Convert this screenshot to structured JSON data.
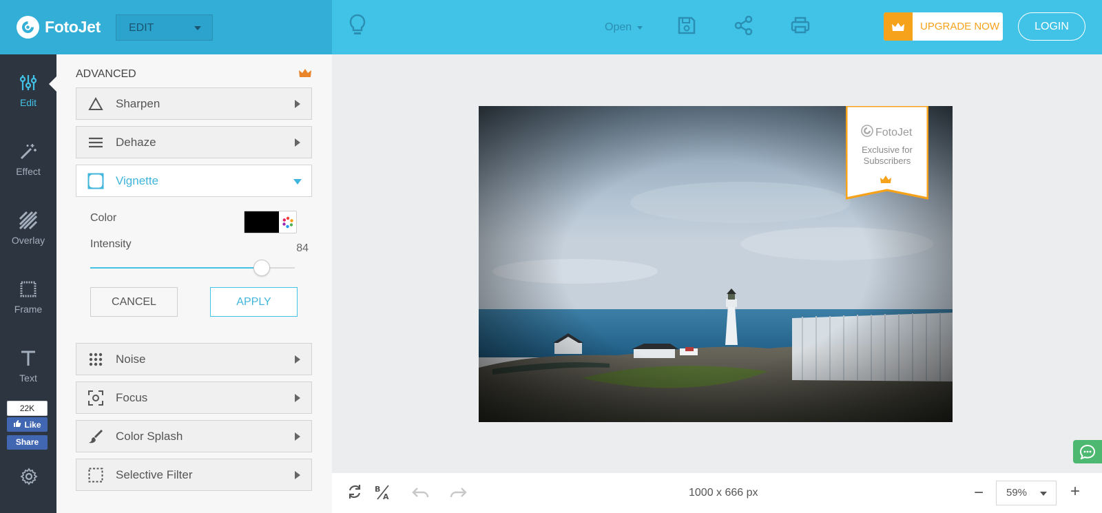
{
  "header": {
    "brand": "FotoJet",
    "mode_label": "EDIT",
    "open_label": "Open",
    "upgrade_label": "UPGRADE NOW",
    "login_label": "LOGIN"
  },
  "rail": {
    "items": [
      {
        "label": "Edit",
        "icon": "sliders-icon",
        "active": true
      },
      {
        "label": "Effect",
        "icon": "magic-wand-icon"
      },
      {
        "label": "Overlay",
        "icon": "overlay-icon"
      },
      {
        "label": "Frame",
        "icon": "frame-icon"
      },
      {
        "label": "Text",
        "icon": "text-icon"
      }
    ],
    "facebook": {
      "count": "22K",
      "like": "Like",
      "share": "Share"
    }
  },
  "panel": {
    "section_title": "ADVANCED",
    "items": [
      {
        "label": "Sharpen",
        "icon": "triangle-icon"
      },
      {
        "label": "Dehaze",
        "icon": "lines-icon"
      },
      {
        "label": "Vignette",
        "icon": "vignette-icon",
        "expanded": true
      },
      {
        "label": "Noise",
        "icon": "dots-grid-icon"
      },
      {
        "label": "Focus",
        "icon": "focus-icon"
      },
      {
        "label": "Color Splash",
        "icon": "brush-icon"
      },
      {
        "label": "Selective Filter",
        "icon": "selection-icon"
      }
    ],
    "vignette": {
      "color_label": "Color",
      "color_value": "#000000",
      "intensity_label": "Intensity",
      "intensity_value": "84",
      "intensity_fraction": 0.84,
      "cancel_label": "CANCEL",
      "apply_label": "APPLY"
    }
  },
  "canvas": {
    "ribbon": {
      "brand": "FotoJet",
      "text_line1": "Exclusive for",
      "text_line2": "Subscribers"
    }
  },
  "bottombar": {
    "dimensions": "1000 x 666 px",
    "zoom": "59%"
  },
  "colors": {
    "accent": "#41c3e7",
    "header_dark": "#33aed6",
    "rail_bg": "#2d3540",
    "upgrade": "#f7a21b",
    "facebook": "#4267b2",
    "chat": "#4cb870"
  }
}
